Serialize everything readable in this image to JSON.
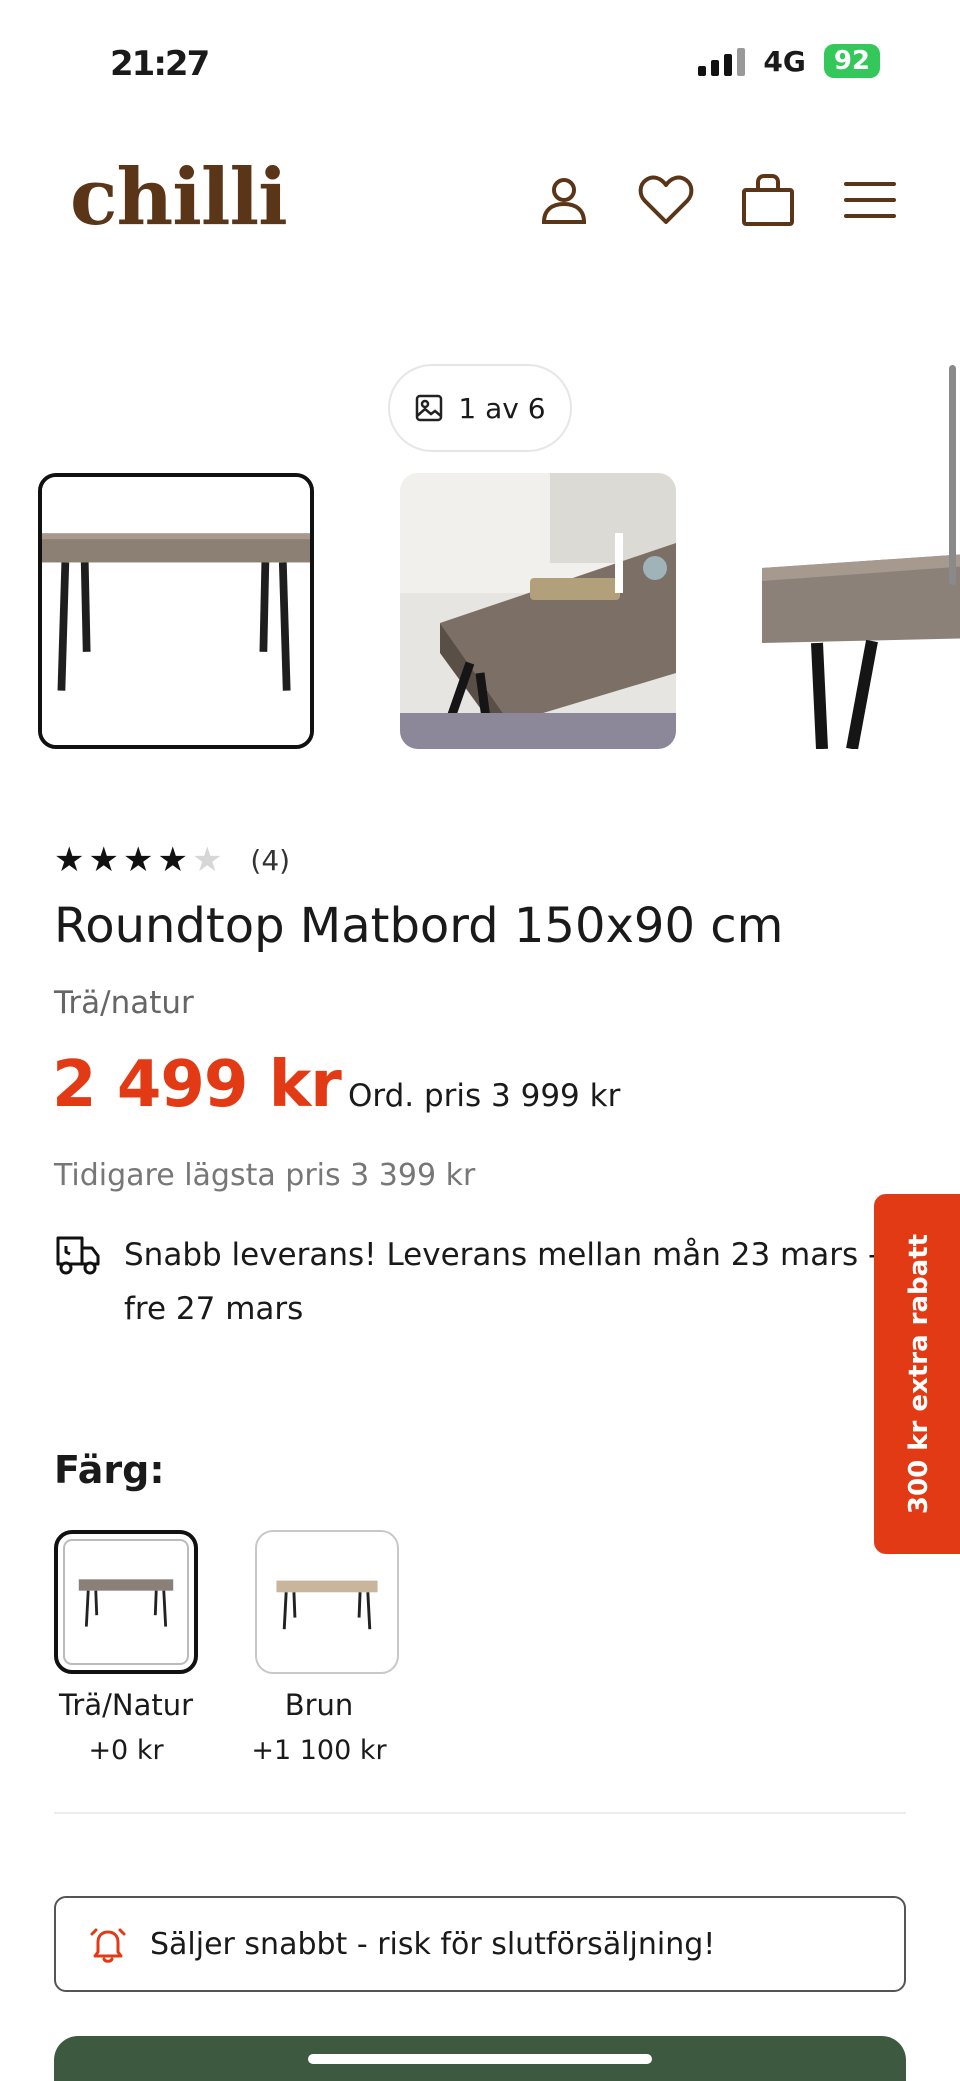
{
  "status_bar": {
    "time": "21:27",
    "network": "4G",
    "battery": "92"
  },
  "header": {
    "logo": "chilli",
    "icons": [
      "account-icon",
      "heart-icon",
      "bag-icon",
      "menu-icon"
    ]
  },
  "gallery": {
    "counter": "1 av 6",
    "images": [
      "table-front-view",
      "table-dining-scene",
      "table-side-view"
    ],
    "selected_index": 0
  },
  "product": {
    "rating": 4,
    "rating_max": 5,
    "review_count": "(4)",
    "title": "Roundtop Matbord 150x90 cm",
    "variant": "Trä/natur",
    "price": "2 499 kr",
    "original_price": "Ord. pris 3 999 kr",
    "lowest_price": "Tidigare lägsta pris 3 399 kr",
    "delivery": "Snabb leverans! Leverans mellan mån 23 mars - fre 27 mars"
  },
  "side_promo": {
    "label": "300 kr extra rabatt",
    "color": "#e23a14"
  },
  "colors": {
    "label": "Färg:",
    "options": [
      {
        "name": "Trä/Natur",
        "price": "+0 kr",
        "selected": true
      },
      {
        "name": "Brun",
        "price": "+1 100 kr",
        "selected": false
      }
    ]
  },
  "alert": {
    "text": "Säljer snabbt - risk för slutförsäljning!"
  },
  "theme": {
    "price_red": "#e23a14",
    "brand_brown": "#5a3518",
    "cta_green": "#3d5a40"
  }
}
